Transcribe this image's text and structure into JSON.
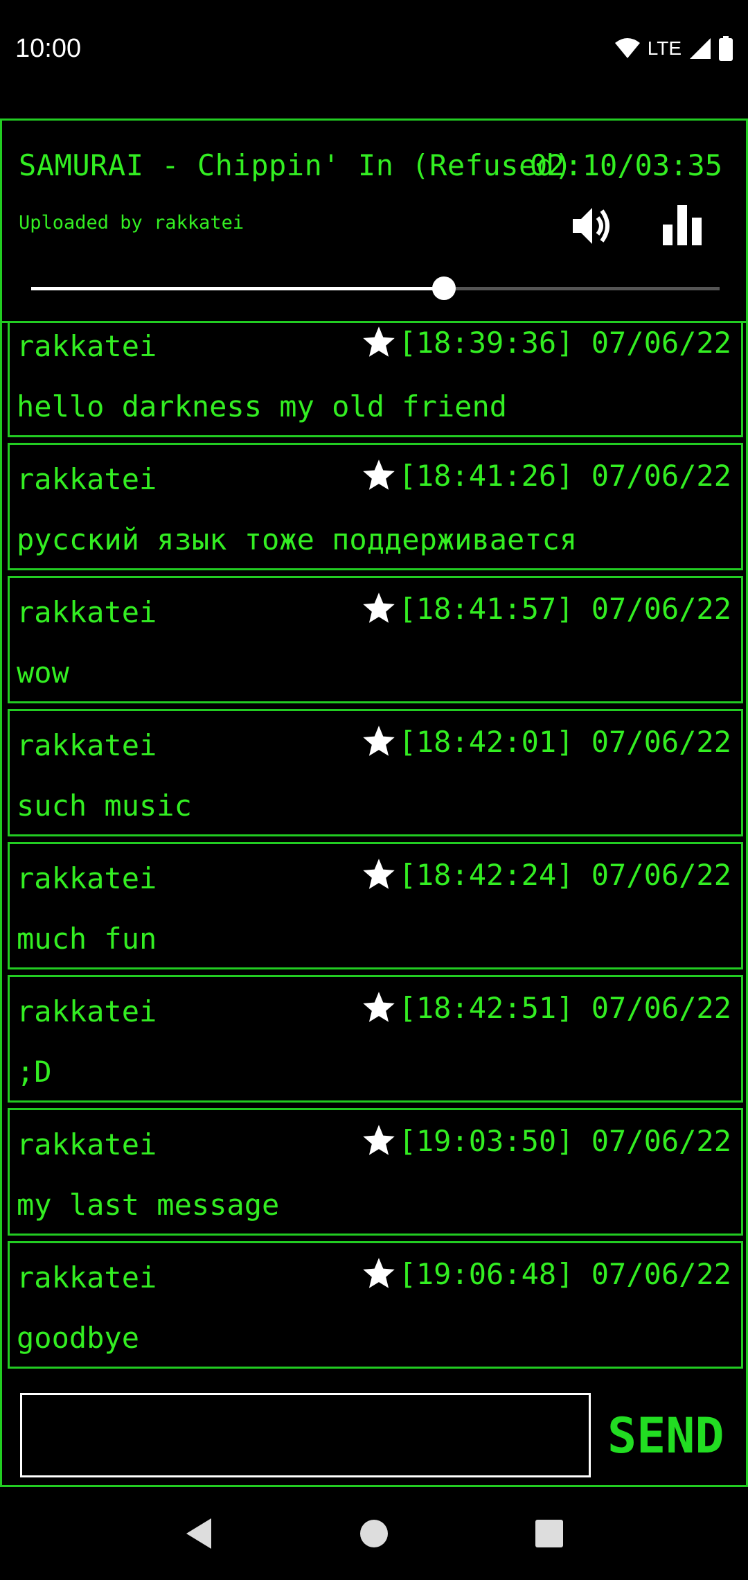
{
  "status_bar": {
    "time": "10:00",
    "network": "LTE",
    "icons": [
      "wifi-icon",
      "signal-icon",
      "battery-icon"
    ]
  },
  "player": {
    "title": "SAMURAI - Chippin' In (Refused)",
    "time": "02:10/03:35",
    "uploader": "Uploaded by rakkatei",
    "progress": 0.6,
    "icons": [
      "volume-icon",
      "equalizer-icon"
    ]
  },
  "messages": [
    {
      "user": "rakkatei",
      "timestamp": "[18:39:36] 07/06/22",
      "text": "hello darkness my old friend"
    },
    {
      "user": "rakkatei",
      "timestamp": "[18:41:26] 07/06/22",
      "text": "русский язык тоже поддерживается"
    },
    {
      "user": "rakkatei",
      "timestamp": "[18:41:57] 07/06/22",
      "text": "wow"
    },
    {
      "user": "rakkatei",
      "timestamp": "[18:42:01] 07/06/22",
      "text": "such music"
    },
    {
      "user": "rakkatei",
      "timestamp": "[18:42:24] 07/06/22",
      "text": "much fun"
    },
    {
      "user": "rakkatei",
      "timestamp": "[18:42:51] 07/06/22",
      "text": ";D"
    },
    {
      "user": "rakkatei",
      "timestamp": "[19:03:50] 07/06/22",
      "text": "my last message"
    },
    {
      "user": "rakkatei",
      "timestamp": "[19:06:48] 07/06/22",
      "text": "goodbye"
    }
  ],
  "composer": {
    "placeholder": "",
    "value": "",
    "send_label": "SEND"
  },
  "colors": {
    "accent_green": "#33ee22",
    "border_green": "#22cc22",
    "background": "#000000"
  }
}
